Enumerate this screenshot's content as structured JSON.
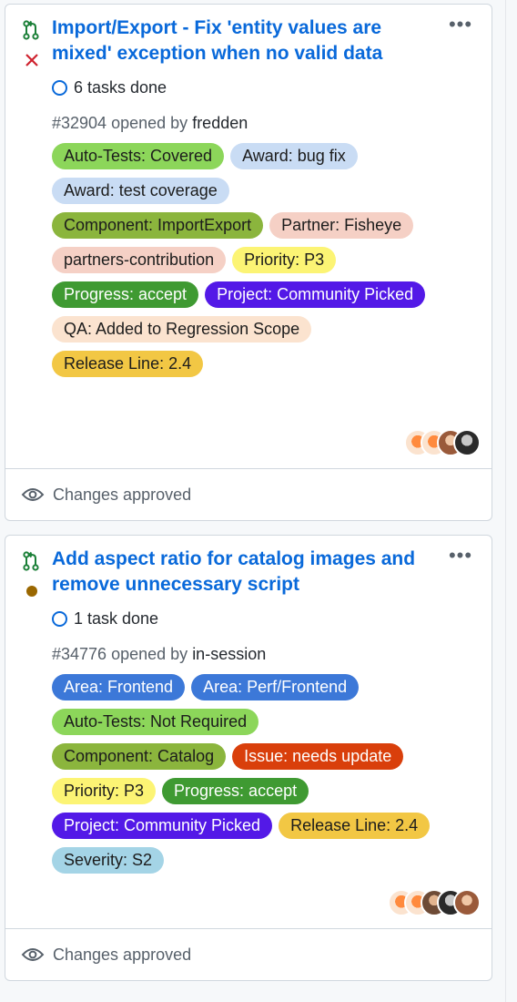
{
  "cards": [
    {
      "title": "Import/Export - Fix 'entity values are mixed' exception when no valid data",
      "tasks": "6 tasks done",
      "number": "#32904",
      "opened_by": "opened by",
      "author": "fredden",
      "labels": [
        {
          "text": "Auto-Tests: Covered",
          "color": "#8cd65a"
        },
        {
          "text": "Award: bug fix",
          "color": "#c9dcf4"
        },
        {
          "text": "Award: test coverage",
          "color": "#c9dcf4"
        },
        {
          "text": "Component: ImportExport",
          "color": "#8bb53d"
        },
        {
          "text": "Partner: Fisheye",
          "color": "#f5d0c5"
        },
        {
          "text": "partners-contribution",
          "color": "#f5d0c5"
        },
        {
          "text": "Priority: P3",
          "color": "#fcf474"
        },
        {
          "text": "Progress: accept",
          "color": "#3f9a32"
        },
        {
          "text": "Project: Community Picked",
          "color": "#5319e7"
        },
        {
          "text": "QA: Added to Regression Scope",
          "color": "#fbe3cf"
        },
        {
          "text": "Release Line: 2.4",
          "color": "#f2c744"
        }
      ],
      "review_status": "Changes approved",
      "state": "closed"
    },
    {
      "title": "Add aspect ratio for catalog images and remove unnecessary script",
      "tasks": "1 task done",
      "number": "#34776",
      "opened_by": "opened by",
      "author": "in-session",
      "labels": [
        {
          "text": "Area: Frontend",
          "color": "#3c78d8"
        },
        {
          "text": "Area: Perf/Frontend",
          "color": "#3c78d8"
        },
        {
          "text": "Auto-Tests: Not Required",
          "color": "#8cd65a"
        },
        {
          "text": "Component: Catalog",
          "color": "#8bb53d"
        },
        {
          "text": "Issue: needs update",
          "color": "#d93f0b"
        },
        {
          "text": "Priority: P3",
          "color": "#fcf474"
        },
        {
          "text": "Progress: accept",
          "color": "#3f9a32"
        },
        {
          "text": "Project: Community Picked",
          "color": "#5319e7"
        },
        {
          "text": "Release Line: 2.4",
          "color": "#f2c744"
        },
        {
          "text": "Severity: S2",
          "color": "#a4d4e6"
        }
      ],
      "review_status": "Changes approved",
      "state": "pending"
    }
  ],
  "icons": {
    "pr": "git-pull-request-icon",
    "closed": "x-icon",
    "pending": "dot-icon",
    "more": "kebab-horizontal-icon",
    "eye": "eye-icon"
  },
  "colors": {
    "link": "#0969da",
    "pr_green": "#1a7f37",
    "fail_red": "#cf222e",
    "pending_dot": "#9a6700"
  }
}
